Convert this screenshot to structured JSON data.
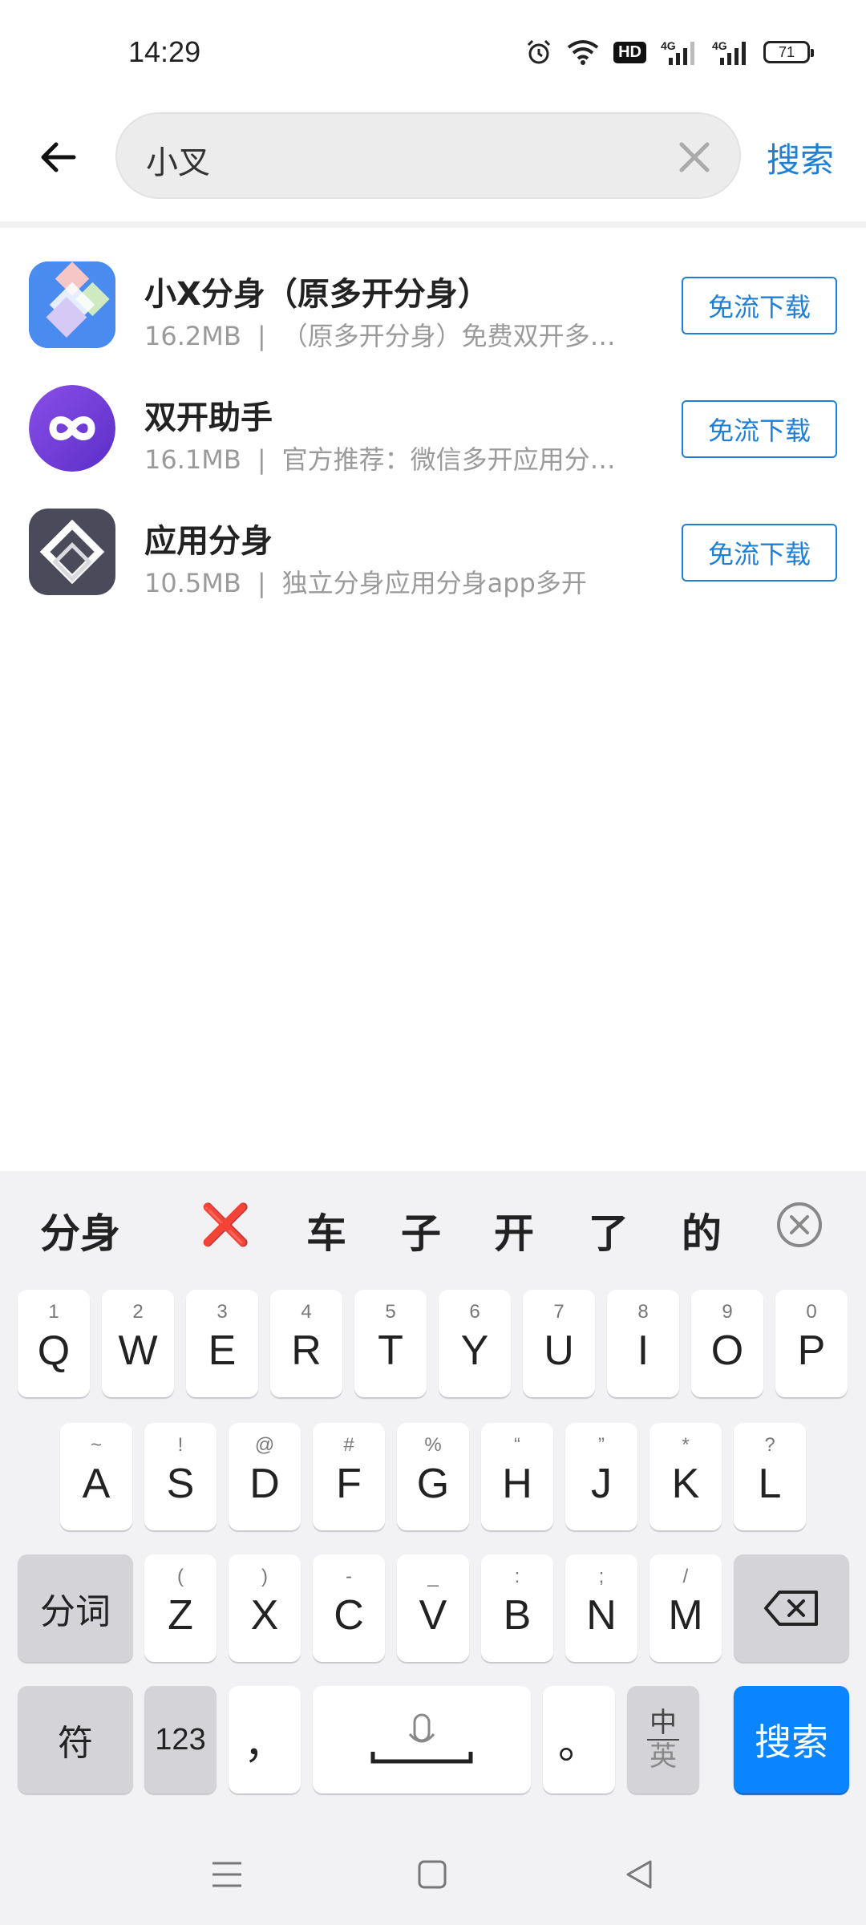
{
  "status_bar": {
    "time": "14:29",
    "hd_label": "HD",
    "net_label_1": "4G",
    "net_label_2": "4G",
    "battery": "71"
  },
  "search": {
    "value": "小叉",
    "submit_label": "搜索"
  },
  "results": [
    {
      "name": "小X分身（原多开分身）",
      "size": "16.2MB",
      "separator": "|",
      "desc": "（原多开分身）免费双开多…",
      "button": "免流下载",
      "icon": "xiaox-app-icon"
    },
    {
      "name": "双开助手",
      "size": "16.1MB",
      "separator": "|",
      "desc": "官方推荐：微信多开应用分…",
      "button": "免流下载",
      "icon": "infinity-app-icon"
    },
    {
      "name": "应用分身",
      "size": "10.5MB",
      "separator": "|",
      "desc": "独立分身应用分身app多开",
      "button": "免流下载",
      "icon": "diamond-app-icon"
    }
  ],
  "keyboard": {
    "candidates": [
      "分身",
      "❌",
      "车",
      "子",
      "开",
      "了",
      "的"
    ],
    "row1": [
      {
        "main": "Q",
        "sub": "1"
      },
      {
        "main": "W",
        "sub": "2"
      },
      {
        "main": "E",
        "sub": "3"
      },
      {
        "main": "R",
        "sub": "4"
      },
      {
        "main": "T",
        "sub": "5"
      },
      {
        "main": "Y",
        "sub": "6"
      },
      {
        "main": "U",
        "sub": "7"
      },
      {
        "main": "I",
        "sub": "8"
      },
      {
        "main": "O",
        "sub": "9"
      },
      {
        "main": "P",
        "sub": "0"
      }
    ],
    "row2": [
      {
        "main": "A",
        "sub": "~"
      },
      {
        "main": "S",
        "sub": "!"
      },
      {
        "main": "D",
        "sub": "@"
      },
      {
        "main": "F",
        "sub": "#"
      },
      {
        "main": "G",
        "sub": "%"
      },
      {
        "main": "H",
        "sub": "“"
      },
      {
        "main": "J",
        "sub": "”"
      },
      {
        "main": "K",
        "sub": "*"
      },
      {
        "main": "L",
        "sub": "?"
      }
    ],
    "row3": [
      {
        "main": "Z",
        "sub": "("
      },
      {
        "main": "X",
        "sub": ")"
      },
      {
        "main": "C",
        "sub": "-"
      },
      {
        "main": "V",
        "sub": "_"
      },
      {
        "main": "B",
        "sub": ":"
      },
      {
        "main": "N",
        "sub": ";"
      },
      {
        "main": "M",
        "sub": "/"
      }
    ],
    "segment_label": "分词",
    "symbol_label": "符",
    "numeric_label": "123",
    "comma_label": "，",
    "period_label": "。",
    "lang_top": "中",
    "lang_bottom": "英",
    "search_label": "搜索"
  },
  "colors": {
    "accent": "#1e7fd6",
    "keyboard_go": "#0a84ff"
  }
}
